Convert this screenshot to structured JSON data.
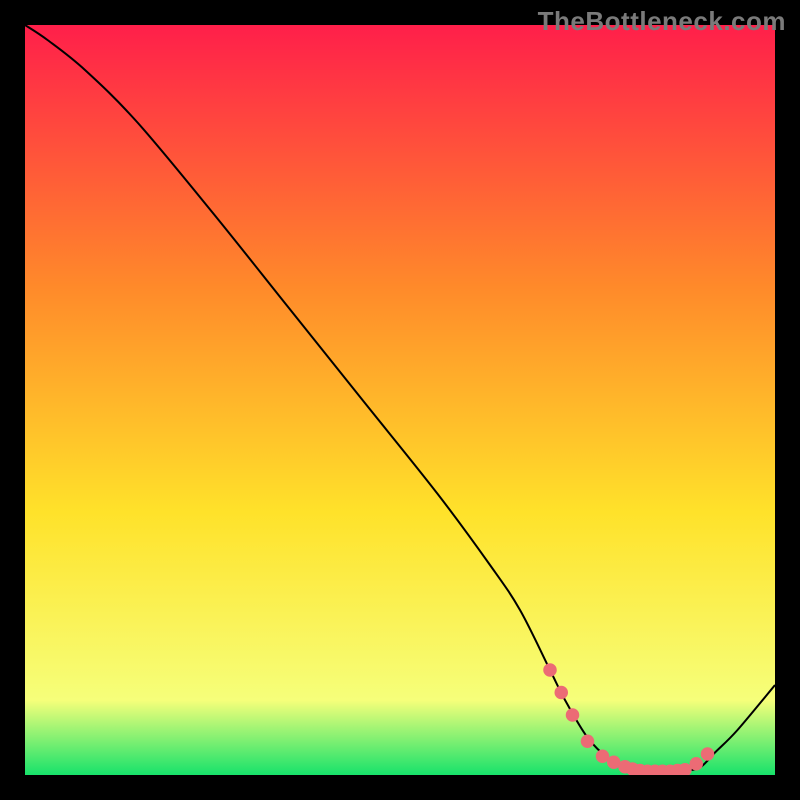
{
  "watermark": "TheBottleneck.com",
  "colors": {
    "gradient_top": "#ff1f4a",
    "gradient_mid1": "#ff8a2a",
    "gradient_mid2": "#ffe22a",
    "gradient_low": "#f6ff7a",
    "gradient_bottom": "#17e26b",
    "curve": "#000000",
    "marker": "#ec6b75",
    "background": "#000000"
  },
  "chart_data": {
    "type": "line",
    "title": "",
    "xlabel": "",
    "ylabel": "",
    "xlim": [
      0,
      100
    ],
    "ylim": [
      0,
      100
    ],
    "grid": false,
    "legend": false,
    "series": [
      {
        "name": "bottleneck-curve",
        "x": [
          0,
          3,
          8,
          15,
          25,
          35,
          45,
          55,
          62,
          66,
          70,
          72,
          75,
          78,
          80,
          82,
          84,
          86,
          88,
          90,
          92,
          95,
          100
        ],
        "y": [
          100,
          98,
          94,
          87,
          75,
          62.5,
          50,
          37.5,
          28,
          22,
          14,
          10,
          5,
          2,
          1,
          0.6,
          0.5,
          0.5,
          0.6,
          1,
          3,
          6,
          12
        ]
      }
    ],
    "markers": {
      "name": "optimal-range-dots",
      "x": [
        70,
        71.5,
        73,
        75,
        77,
        78.5,
        80,
        81,
        82,
        83,
        84,
        85,
        86,
        87,
        88,
        89.5,
        91
      ],
      "y": [
        14,
        11,
        8,
        4.5,
        2.5,
        1.7,
        1.1,
        0.8,
        0.6,
        0.5,
        0.5,
        0.5,
        0.5,
        0.6,
        0.7,
        1.5,
        2.8
      ]
    }
  }
}
